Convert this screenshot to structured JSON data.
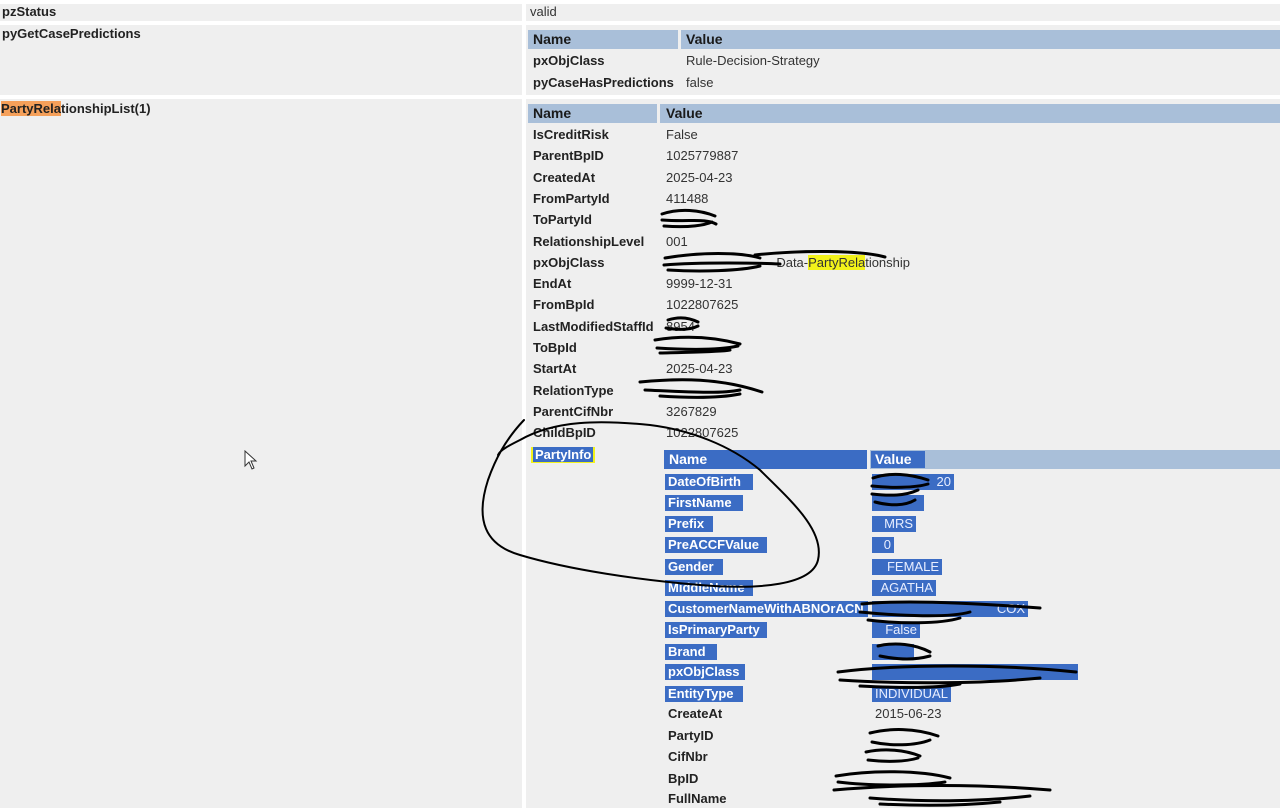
{
  "top": {
    "pzStatus_label": "pzStatus",
    "pzStatus_value": "valid",
    "predictions_label": "pyGetCasePredictions"
  },
  "predictions_table": {
    "col_name": "Name",
    "col_value": "Value",
    "rows": [
      {
        "name": "pxObjClass",
        "value": "Rule-Decision-Strategy"
      },
      {
        "name": "pyCaseHasPredictions",
        "value": "false"
      }
    ]
  },
  "party_list": {
    "label_highlight": "PartyRela",
    "label_rest": "tionshipList(1)",
    "col_name": "Name",
    "col_value": "Value",
    "rows": [
      {
        "name": "IsCreditRisk",
        "value": "False"
      },
      {
        "name": "ParentBpID",
        "value": "1025779887"
      },
      {
        "name": "CreatedAt",
        "value": "2025-04-23"
      },
      {
        "name": "FromPartyId",
        "value": "411488"
      },
      {
        "name": "ToPartyId",
        "value": ""
      },
      {
        "name": "RelationshipLevel",
        "value": "001"
      },
      {
        "name": "pxObjClass",
        "value": "-Data-",
        "value_highlight": "PartyRela",
        "value_tail": "tionship"
      },
      {
        "name": "EndAt",
        "value": "9999-12-31"
      },
      {
        "name": "FromBpId",
        "value": "1022807625"
      },
      {
        "name": "LastModifiedStaffId",
        "value": "8954"
      },
      {
        "name": "ToBpId",
        "value": ""
      },
      {
        "name": "StartAt",
        "value": "2025-04-23"
      },
      {
        "name": "RelationType",
        "value": ""
      },
      {
        "name": "ParentCifNbr",
        "value": "3267829"
      },
      {
        "name": "ChildBpID",
        "value": "1022807625"
      }
    ]
  },
  "party_info": {
    "label": "PartyInfo",
    "col_name": "Name",
    "col_value": "Value",
    "rows": [
      {
        "name": "DateOfBirth",
        "value": "20",
        "selected": true
      },
      {
        "name": "FirstName",
        "value": "",
        "selected": true
      },
      {
        "name": "Prefix",
        "value": "MRS",
        "selected": true
      },
      {
        "name": "PreACCFValue",
        "value": "0",
        "selected": true
      },
      {
        "name": "Gender",
        "value": "FEMALE",
        "selected": true
      },
      {
        "name": "MiddleName",
        "value": "AGATHA",
        "selected": true
      },
      {
        "name": "CustomerNameWithABNOrACN",
        "value": "COX",
        "selected": true
      },
      {
        "name": "IsPrimaryParty",
        "value": "False",
        "selected": true
      },
      {
        "name": "Brand",
        "value": "",
        "selected": true
      },
      {
        "name": "pxObjClass",
        "value": "",
        "selected": true
      },
      {
        "name": "EntityType",
        "value": "INDIVIDUAL",
        "selected": true
      },
      {
        "name": "CreateAt",
        "value": "2015-06-23",
        "selected": false
      },
      {
        "name": "PartyID",
        "value": "",
        "selected": false
      },
      {
        "name": "CifNbr",
        "value": "",
        "selected": false
      },
      {
        "name": "BpID",
        "value": "",
        "selected": false
      },
      {
        "name": "FullName",
        "value": "",
        "selected": false
      }
    ]
  },
  "colors": {
    "header_bg": "#a9bfd9",
    "panel_bg": "#efefef",
    "selection": "#3b6cc4",
    "orange_highlight": "#f5a05a",
    "yellow_highlight": "#f2f21a"
  }
}
